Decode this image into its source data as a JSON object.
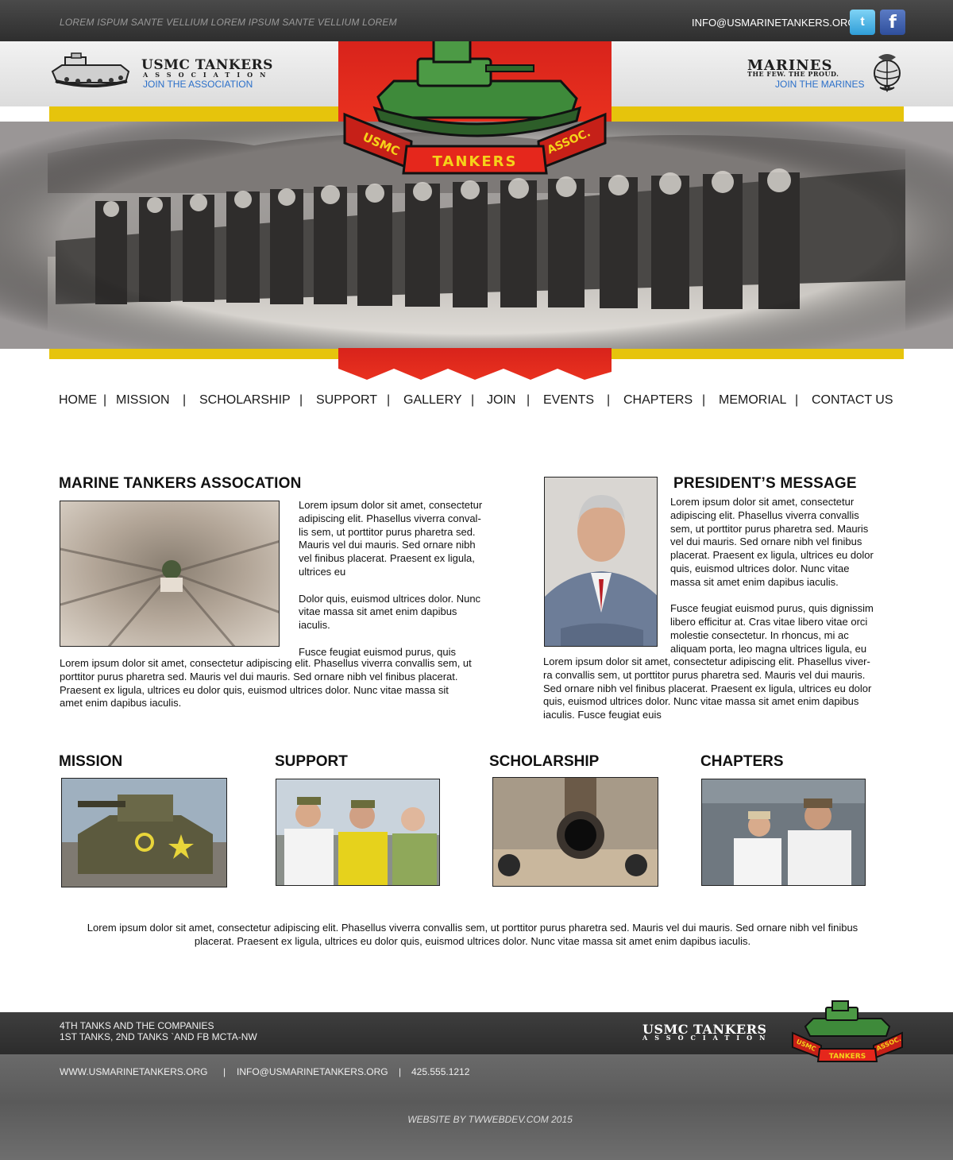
{
  "topbar": {
    "tagline": "LOREM ISPUM SANTE VELLIUM LOREM IPSUM SANTE VELLIUM LOREM",
    "email": "INFO@USMARINETANKERS.ORG",
    "twitter_glyph": "t",
    "facebook_glyph": "f"
  },
  "header": {
    "brand_title": "USMC TANKERS",
    "brand_subtitle": "ASSOCIATION",
    "join_association": "JOIN THE ASSOCIATION",
    "marines_title": "MARINES",
    "marines_subtitle": "THE FEW. THE PROUD.",
    "join_marines": "JOIN THE MARINES"
  },
  "emblem": {
    "left_ribbon": "USMC",
    "center_ribbon": "TANKERS",
    "right_ribbon": "ASSOC."
  },
  "nav": {
    "items": [
      "HOME",
      "MISSION",
      "SCHOLARSHIP",
      "SUPPORT",
      "GALLERY",
      "JOIN",
      "EVENTS",
      "CHAPTERS",
      "MEMORIAL",
      "CONTACT US"
    ],
    "separator": "|"
  },
  "association": {
    "heading": "MARINE TANKERS ASSOCATION",
    "wrap_lines": [
      "Lorem ipsum dolor sit amet, consectetur",
      "adipiscing elit. Phasellus viverra conval-",
      "lis sem, ut porttitor purus pharetra sed.",
      "Mauris vel dui mauris. Sed ornare nibh",
      "vel finibus placerat. Praesent ex ligula,",
      "ultrices eu",
      "",
      "Dolor quis, euismod ultrices dolor. Nunc",
      "vitae massa sit amet enim dapibus",
      "iaculis.",
      "",
      "Fusce feugiat euismod purus, quis"
    ],
    "full_lines": [
      "Lorem ipsum dolor sit amet, consectetur adipiscing elit. Phasellus viverra convallis sem, ut",
      "porttitor purus pharetra sed. Mauris vel dui mauris. Sed ornare nibh vel finibus placerat.",
      "Praesent ex ligula, ultrices eu dolor quis, euismod ultrices dolor. Nunc vitae massa sit",
      "amet enim dapibus iaculis."
    ]
  },
  "president": {
    "heading": "PRESIDENT’S MESSAGE",
    "wrap_lines": [
      "Lorem ipsum dolor sit amet, consectetur",
      "adipiscing elit. Phasellus viverra convallis",
      "sem, ut porttitor purus pharetra sed. Mauris",
      "vel dui mauris. Sed ornare nibh vel finibus",
      "placerat. Praesent ex ligula, ultrices eu dolor",
      "quis, euismod ultrices dolor. Nunc vitae",
      "massa sit amet enim dapibus iaculis.",
      "",
      "Fusce feugiat euismod purus, quis dignissim",
      "libero efficitur at. Cras vitae libero vitae orci",
      "molestie consectetur. In rhoncus, mi ac",
      "aliquam porta, leo magna ultrices ligula, eu"
    ],
    "full_lines": [
      "Lorem ipsum dolor sit amet, consectetur adipiscing elit. Phasellus viver-",
      "ra convallis sem, ut porttitor purus pharetra sed. Mauris vel dui mauris.",
      "Sed ornare nibh vel finibus placerat. Praesent ex ligula, ultrices eu dolor",
      "quis, euismod ultrices dolor. Nunc vitae massa sit amet enim dapibus",
      "iaculis. Fusce feugiat euis"
    ]
  },
  "features": [
    {
      "heading": "MISSION"
    },
    {
      "heading": "SUPPORT"
    },
    {
      "heading": "SCHOLARSHIP"
    },
    {
      "heading": "CHAPTERS"
    }
  ],
  "summary": [
    "Lorem ipsum dolor sit amet, consectetur adipiscing elit. Phasellus viverra convallis sem, ut porttitor purus pharetra sed. Mauris vel dui mauris. Sed ornare nibh vel finibus",
    "placerat. Praesent ex ligula, ultrices eu dolor quis, euismod ultrices dolor. Nunc vitae massa sit amet enim dapibus iaculis."
  ],
  "footer": {
    "units_line1": "4TH TANKS AND THE COMPANIES",
    "units_line2": "1ST TANKS, 2ND TANKS `AND FB MCTA-NW",
    "brand_title": "USMC TANKERS",
    "brand_subtitle": "ASSOCIATION",
    "website": "WWW.USMARINETANKERS.ORG",
    "email": "INFO@USMARINETANKERS.ORG",
    "phone": "425.555.1212",
    "separator": "|",
    "credit": "WEBSITE BY TWWEBDEV.COM 2015"
  }
}
